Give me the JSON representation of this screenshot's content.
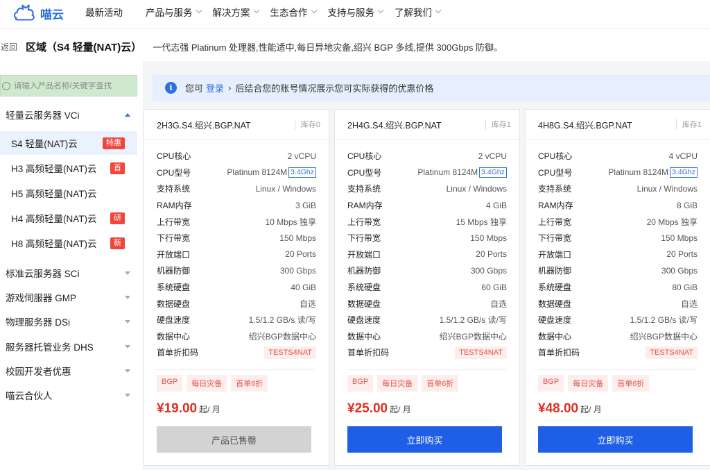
{
  "brand": {
    "name": "喵云"
  },
  "nav": [
    {
      "label": "最新活动",
      "dropdown": false
    },
    {
      "label": "产品与服务",
      "dropdown": true
    },
    {
      "label": "解决方案",
      "dropdown": true
    },
    {
      "label": "生态合作",
      "dropdown": true
    },
    {
      "label": "支持与服务",
      "dropdown": true
    },
    {
      "label": "了解我们",
      "dropdown": true
    }
  ],
  "header": {
    "back": "返回",
    "region": "区域（S4 轻量(NAT)云）",
    "description": "一代志强 Platinum 处理器,性能适中,每日异地灾备,绍兴 BGP 多线,提供 300Gbps 防御。"
  },
  "sidebar": {
    "search_placeholder": "请输入产品名称/关键字查找",
    "categories": [
      {
        "label": "轻量云服务器 VCi",
        "expanded": true
      },
      {
        "label": "标准云服务器 SCi",
        "expanded": false
      },
      {
        "label": "游戏伺服器 GMP",
        "expanded": false
      },
      {
        "label": "物理服务器 DSi",
        "expanded": false
      },
      {
        "label": "服务器托管业务 DHS",
        "expanded": false
      },
      {
        "label": "校园开发者优惠",
        "expanded": false
      },
      {
        "label": "喵云合伙人",
        "expanded": false
      }
    ],
    "subitems": [
      {
        "label": "S4 轻量(NAT)云",
        "badge": "特惠",
        "active": true
      },
      {
        "label": "H3 高频轻量(NAT)云",
        "badge": "首",
        "active": false
      },
      {
        "label": "H5 高频轻量(NAT)云",
        "badge": "",
        "active": false
      },
      {
        "label": "H4 高频轻量(NAT)云",
        "badge": "研",
        "active": false
      },
      {
        "label": "H8 高频轻量(NAT)云",
        "badge": "新",
        "active": false
      }
    ]
  },
  "notice": {
    "prefix": "您可",
    "link": "登录",
    "arrow": "›",
    "suffix": "后结合您的账号情况展示您可实际获得的优惠价格"
  },
  "products": [
    {
      "name": "2H3G.S4.绍兴.BGP.NAT",
      "stock": "库存0",
      "specs": [
        {
          "k": "CPU核心",
          "v": "2 vCPU"
        },
        {
          "k": "CPU型号",
          "v": "Platinum 8124M",
          "badge": "3.4Ghz"
        },
        {
          "k": "支持系统",
          "v": "Linux / Windows"
        },
        {
          "k": "RAM内存",
          "v": "3 GiB"
        },
        {
          "k": "上行带宽",
          "v": "10 Mbps 独享"
        },
        {
          "k": "下行带宽",
          "v": "150 Mbps"
        },
        {
          "k": "开放端口",
          "v": "20 Ports"
        },
        {
          "k": "机器防御",
          "v": "300 Gbps"
        },
        {
          "k": "系统硬盘",
          "v": "40 GiB"
        },
        {
          "k": "数据硬盘",
          "v": "自选"
        },
        {
          "k": "硬盘速度",
          "v": "1.5/1.2 GB/s 读/写"
        },
        {
          "k": "数据中心",
          "v": "绍兴BGP数据中心"
        },
        {
          "k": "首单折扣码",
          "v": "",
          "code": "TESTS4NAT"
        }
      ],
      "tags": [
        "BGP",
        "每日灾备",
        "首单6折"
      ],
      "price": "¥19.00",
      "unit": "起/ 月",
      "button": "产品已售罄",
      "sold_out": true
    },
    {
      "name": "2H4G.S4.绍兴.BGP.NAT",
      "stock": "库存1",
      "specs": [
        {
          "k": "CPU核心",
          "v": "2 vCPU"
        },
        {
          "k": "CPU型号",
          "v": "Platinum 8124M",
          "badge": "3.4Ghz"
        },
        {
          "k": "支持系统",
          "v": "Linux / Windows"
        },
        {
          "k": "RAM内存",
          "v": "4 GiB"
        },
        {
          "k": "上行带宽",
          "v": "15 Mbps 独享"
        },
        {
          "k": "下行带宽",
          "v": "150 Mbps"
        },
        {
          "k": "开放端口",
          "v": "20 Ports"
        },
        {
          "k": "机器防御",
          "v": "300 Gbps"
        },
        {
          "k": "系统硬盘",
          "v": "60 GiB"
        },
        {
          "k": "数据硬盘",
          "v": "自选"
        },
        {
          "k": "硬盘速度",
          "v": "1.5/1.2 GB/s 读/写"
        },
        {
          "k": "数据中心",
          "v": "绍兴BGP数据中心"
        },
        {
          "k": "首单折扣码",
          "v": "",
          "code": "TESTS4NAT"
        }
      ],
      "tags": [
        "BGP",
        "每日灾备",
        "首单6折"
      ],
      "price": "¥25.00",
      "unit": "起/ 月",
      "button": "立即购买",
      "sold_out": false
    },
    {
      "name": "4H8G.S4.绍兴.BGP.NAT",
      "stock": "库存1",
      "specs": [
        {
          "k": "CPU核心",
          "v": "4 vCPU"
        },
        {
          "k": "CPU型号",
          "v": "Platinum 8124M",
          "badge": "3.4Ghz"
        },
        {
          "k": "支持系统",
          "v": "Linux / Windows"
        },
        {
          "k": "RAM内存",
          "v": "8 GiB"
        },
        {
          "k": "上行带宽",
          "v": "20 Mbps 独享"
        },
        {
          "k": "下行带宽",
          "v": "150 Mbps"
        },
        {
          "k": "开放端口",
          "v": "20 Ports"
        },
        {
          "k": "机器防御",
          "v": "300 Gbps"
        },
        {
          "k": "系统硬盘",
          "v": "80 GiB"
        },
        {
          "k": "数据硬盘",
          "v": "自选"
        },
        {
          "k": "硬盘速度",
          "v": "1.5/1.2 GB/s 读/写"
        },
        {
          "k": "数据中心",
          "v": "绍兴BGP数据中心"
        },
        {
          "k": "首单折扣码",
          "v": "",
          "code": "TESTS4NAT"
        }
      ],
      "tags": [
        "BGP",
        "每日灾备",
        "首单6折"
      ],
      "price": "¥48.00",
      "unit": "起/ 月",
      "button": "立即购买",
      "sold_out": false
    }
  ],
  "colors": {
    "accent": "#1f5fe6",
    "price": "#e02e24",
    "badge_red": "#f0463c"
  }
}
